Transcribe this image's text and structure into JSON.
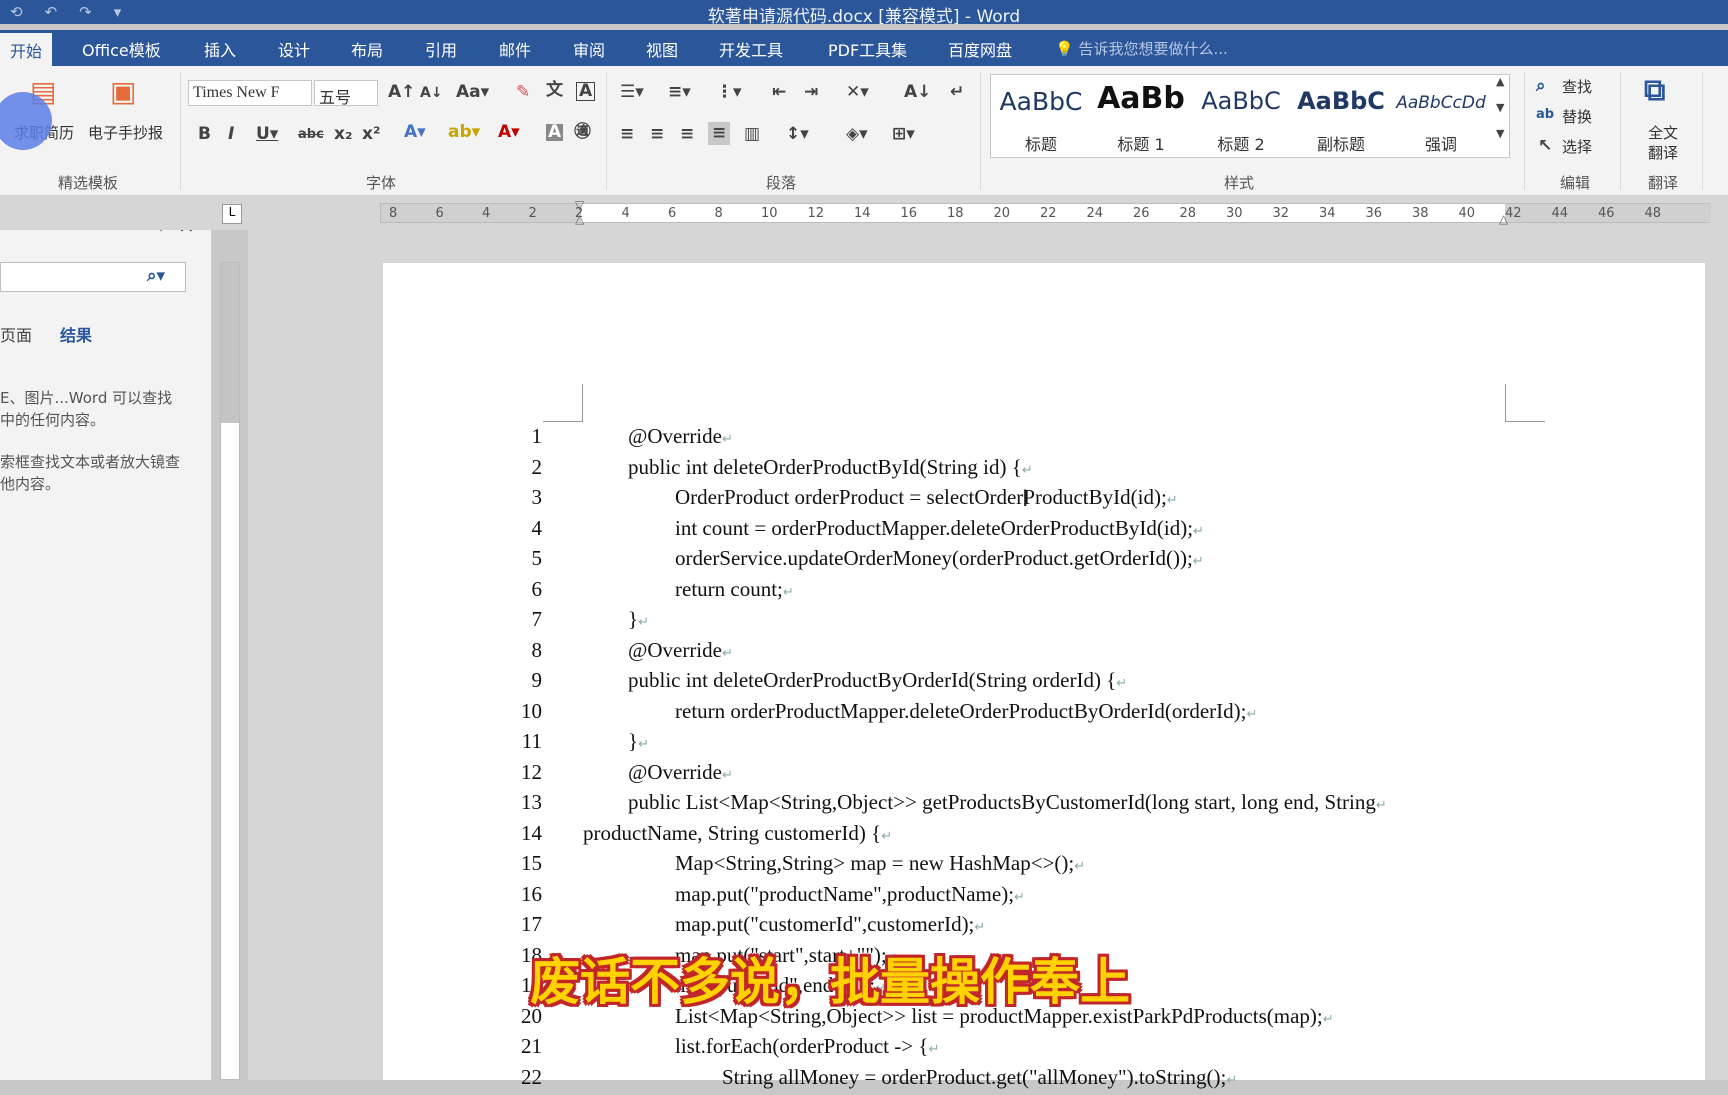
{
  "window": {
    "title": "软著申请源代码.docx [兼容模式] - Word"
  },
  "qat": [
    "⟲",
    "↶",
    "↷",
    "▾"
  ],
  "tabs": [
    "开始",
    "Office模板",
    "插入",
    "设计",
    "布局",
    "引用",
    "邮件",
    "审阅",
    "视图",
    "开发工具",
    "PDF工具集",
    "百度网盘"
  ],
  "tell_me": "告诉我您想要做什么...",
  "ribbon": {
    "templates": {
      "btn1": "求职简历",
      "btn2": "电子手抄报",
      "label": "精选模板"
    },
    "font": {
      "name": "Times New F",
      "size": "五号",
      "label": "字体"
    },
    "paragraph": {
      "label": "段落"
    },
    "styles": {
      "label": "样式",
      "items": [
        {
          "sample": "AaBbC",
          "name": "标题"
        },
        {
          "sample": "AaBb",
          "name": "标题 1"
        },
        {
          "sample": "AaBbC",
          "name": "标题 2"
        },
        {
          "sample": "AaBbC",
          "name": "副标题"
        },
        {
          "sample": "AaBbCcDd",
          "name": "强调"
        }
      ]
    },
    "editing": {
      "find": "查找",
      "replace": "替换",
      "select": "选择",
      "label": "编辑"
    },
    "translate": {
      "btn_line1": "全文",
      "btn_line2": "翻译",
      "label": "翻译"
    }
  },
  "ruler_numbers": [
    "8",
    "6",
    "4",
    "2",
    "2",
    "4",
    "6",
    "8",
    "10",
    "12",
    "14",
    "16",
    "18",
    "20",
    "22",
    "24",
    "26",
    "28",
    "30",
    "32",
    "34",
    "36",
    "38",
    "40",
    "42",
    "44",
    "46",
    "48"
  ],
  "nav": {
    "tab_pages": "页面",
    "tab_results": "结果",
    "hint1_l1": "E、图片...Word 可以查找",
    "hint1_l2": "中的任何内容。",
    "hint2_l1": "索框查找文本或者放大镜查",
    "hint2_l2": "他内容。"
  },
  "code": [
    {
      "n": "1",
      "indent": 1,
      "text": "@Override"
    },
    {
      "n": "2",
      "indent": 1,
      "text": "public int deleteOrderProductById(String id) {"
    },
    {
      "n": "3",
      "indent": 2,
      "text": "OrderProduct orderProduct = selectOrderProductById(id);"
    },
    {
      "n": "4",
      "indent": 2,
      "text": "int count = orderProductMapper.deleteOrderProductById(id);"
    },
    {
      "n": "5",
      "indent": 2,
      "text": "orderService.updateOrderMoney(orderProduct.getOrderId());"
    },
    {
      "n": "6",
      "indent": 2,
      "text": "return count;"
    },
    {
      "n": "7",
      "indent": 1,
      "text": "}"
    },
    {
      "n": "8",
      "indent": 1,
      "text": "@Override"
    },
    {
      "n": "9",
      "indent": 1,
      "text": "public int deleteOrderProductByOrderId(String orderId) {"
    },
    {
      "n": "10",
      "indent": 2,
      "text": "return orderProductMapper.deleteOrderProductByOrderId(orderId);"
    },
    {
      "n": "11",
      "indent": 1,
      "text": "}"
    },
    {
      "n": "12",
      "indent": 1,
      "text": "@Override"
    },
    {
      "n": "13",
      "indent": 1,
      "text": "public   List<Map<String,Object>>   getProductsByCustomerId(long   start,   long   end,   String"
    },
    {
      "n": "14",
      "indent": 0,
      "text": "productName, String customerId) {"
    },
    {
      "n": "15",
      "indent": 2,
      "text": "Map<String,String> map = new HashMap<>();"
    },
    {
      "n": "16",
      "indent": 2,
      "text": "map.put(\"productName\",productName);"
    },
    {
      "n": "17",
      "indent": 2,
      "text": "map.put(\"customerId\",customerId);"
    },
    {
      "n": "18",
      "indent": 2,
      "text": "map.put(\"start\",start+\"\");"
    },
    {
      "n": "19",
      "indent": 2,
      "text": "map.put(\"end\",end+\"\");"
    },
    {
      "n": "20",
      "indent": 2,
      "text": "List<Map<String,Object>> list = productMapper.existParkPdProducts(map);"
    },
    {
      "n": "21",
      "indent": 2,
      "text": "list.forEach(orderProduct -> {"
    },
    {
      "n": "22",
      "indent": 3,
      "text": "String allMoney = orderProduct.get(\"allMoney\").toString();"
    }
  ],
  "paragraph_mark": "↵",
  "subtitle": "废话不多说，批量操作奉上"
}
